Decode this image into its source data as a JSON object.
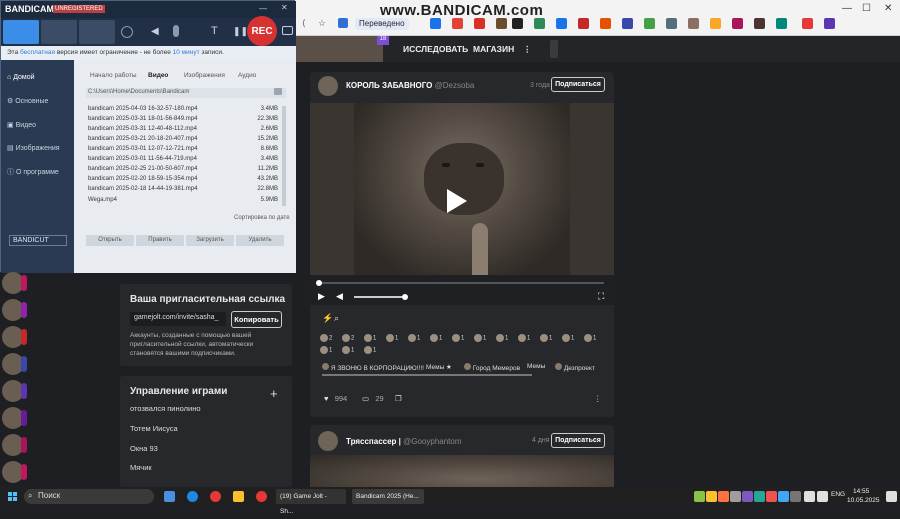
{
  "browser": {
    "watermark": "www.BANDICAM.com",
    "translated_label": "Переведено",
    "tab_badge": "18"
  },
  "bandicam": {
    "logo": "BANDICAM",
    "unregistered": "UNREGISTERED",
    "rec_label": "REC",
    "notice": {
      "prefix": "Эта ",
      "highlight1": "бесплатная",
      "middle": " версия имеет ограничение - не более ",
      "highlight2": "10 минут",
      "suffix": " записи."
    },
    "sidebar": [
      {
        "label": "Домой"
      },
      {
        "label": "Основные"
      },
      {
        "label": "Видео"
      },
      {
        "label": "Изображения"
      },
      {
        "label": "О программе"
      }
    ],
    "bandicut": "BANDICUT",
    "tabs": [
      {
        "label": "Начало работы"
      },
      {
        "label": "Видео"
      },
      {
        "label": "Изображения"
      },
      {
        "label": "Аудио"
      }
    ],
    "path": "C:\\Users\\Home\\Documents\\Bandicam",
    "files": [
      {
        "name": "bandicam 2025-04-03 16-32-57-180.mp4",
        "size": "3.4MB"
      },
      {
        "name": "bandicam 2025-03-31 18-01-56-849.mp4",
        "size": "22.3MB"
      },
      {
        "name": "bandicam 2025-03-31 12-40-48-112.mp4",
        "size": "2.6MB"
      },
      {
        "name": "bandicam 2025-03-21 20-18-20-407.mp4",
        "size": "15.2MB"
      },
      {
        "name": "bandicam 2025-03-01 12-07-12-721.mp4",
        "size": "8.6MB"
      },
      {
        "name": "bandicam 2025-03-01 11-56-44-719.mp4",
        "size": "3.4MB"
      },
      {
        "name": "bandicam 2025-02-25 21-00-50-607.mp4",
        "size": "11.2MB"
      },
      {
        "name": "bandicam 2025-02-20 18-59-15-354.mp4",
        "size": "43.2MB"
      },
      {
        "name": "bandicam 2025-02-18 14-44-19-381.mp4",
        "size": "22.8MB"
      },
      {
        "name": "Wega.mp4",
        "size": "5.9MB"
      }
    ],
    "sort_label": "Сортировка по дате",
    "buttons": [
      "Открыть",
      "Править",
      "Загрузить",
      "Удалить"
    ]
  },
  "invite": {
    "title": "Ваша пригласительная ссылка",
    "link": "gamejolt.com/invite/sasha_",
    "copy_label": "Копировать",
    "text": "Аккаунты, созданные с помощью вашей пригласительной ссылки, автоматически становятся вашими подписчиками."
  },
  "games": {
    "title": "Управление играми",
    "add": "+",
    "items": [
      "отозвался пинолино",
      "Тотем Иисуса",
      "Окна 93",
      "Мячик"
    ]
  },
  "nav": {
    "explore": "ИССЛЕДОВАТЬ",
    "store": "МАГАЗИН",
    "more": "⋮"
  },
  "post1": {
    "author": "КОРОЛЬ ЗАБАВНОГО",
    "handle": "@Dezsoba",
    "time": "3 года",
    "subscribe": "Подписаться",
    "reactions": [
      "2",
      "2",
      "1",
      "1",
      "1",
      "1",
      "1",
      "1",
      "1",
      "1",
      "1",
      "1",
      "1",
      "1",
      "1",
      "1"
    ],
    "tags": [
      "Я ЗВОНЮ В КОРПОРАЦИЮ!!!!",
      "Мемы ★",
      "Город Мемеров",
      "Мемы",
      "Дезпроект"
    ],
    "likes": "994",
    "comments": "29"
  },
  "post2": {
    "author": "Трясспассер |",
    "handle": "@Gooyphantom",
    "time": "4 дня",
    "subscribe": "Подписаться"
  },
  "taskbar": {
    "search": "Поиск",
    "tasks": [
      "(19) Game Jolt - Sh...",
      "Bandicam 2025 (Не..."
    ],
    "lang": "ENG",
    "time": "14:55",
    "date": "10.05.2025"
  },
  "colors": {
    "bandicam_bg": "#2e3e55",
    "rec": "#d73232",
    "dark_bg": "#1e1f22"
  }
}
